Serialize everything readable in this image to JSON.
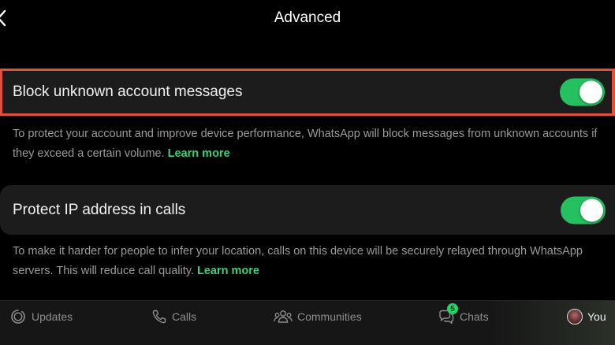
{
  "colors": {
    "accent": "#25d366",
    "toggle_on": "#25c060",
    "highlight_border": "#e0503e",
    "link": "#3bd07a"
  },
  "header": {
    "title": "Advanced",
    "back_icon": "chevron-left-icon"
  },
  "settings": [
    {
      "label": "Block unknown account messages",
      "enabled": true,
      "description": "To protect your account and improve device performance, WhatsApp will block messages from unknown accounts if they exceed a certain volume.",
      "link": "Learn more"
    },
    {
      "label": "Protect IP address in calls",
      "enabled": true,
      "description": "To make it harder for people to infer your location, calls on this device will be securely relayed through WhatsApp servers. This will reduce call quality.",
      "link": "Learn more"
    }
  ],
  "tabbar": {
    "tabs": [
      {
        "label": "Updates",
        "icon": "updates-icon"
      },
      {
        "label": "Calls",
        "icon": "phone-icon"
      },
      {
        "label": "Communities",
        "icon": "communities-icon"
      },
      {
        "label": "Chats",
        "icon": "chat-bubbles-icon",
        "badge": "5"
      },
      {
        "label": "You",
        "icon": "avatar"
      }
    ]
  }
}
